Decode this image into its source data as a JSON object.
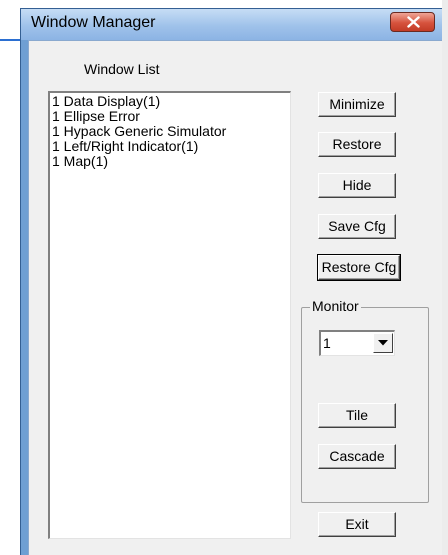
{
  "window": {
    "title": "Window Manager"
  },
  "window_list": {
    "label": "Window List",
    "items": [
      "1 Data Display(1)",
      "1 Ellipse Error",
      "1 Hypack Generic Simulator",
      "1 Left/Right Indicator(1)",
      "1 Map(1)"
    ]
  },
  "buttons": {
    "minimize": "Minimize",
    "restore": "Restore",
    "hide": "Hide",
    "save_cfg": "Save Cfg",
    "restore_cfg": "Restore Cfg",
    "tile": "Tile",
    "cascade": "Cascade",
    "exit": "Exit"
  },
  "monitor": {
    "label": "Monitor",
    "selected": "1"
  },
  "icons": {
    "close": "close-icon",
    "dropdown": "chevron-down-icon"
  },
  "colors": {
    "titlebar": "#9fc2ea",
    "close_button": "#d6533d",
    "dialog_bg": "#f0f0f0"
  }
}
